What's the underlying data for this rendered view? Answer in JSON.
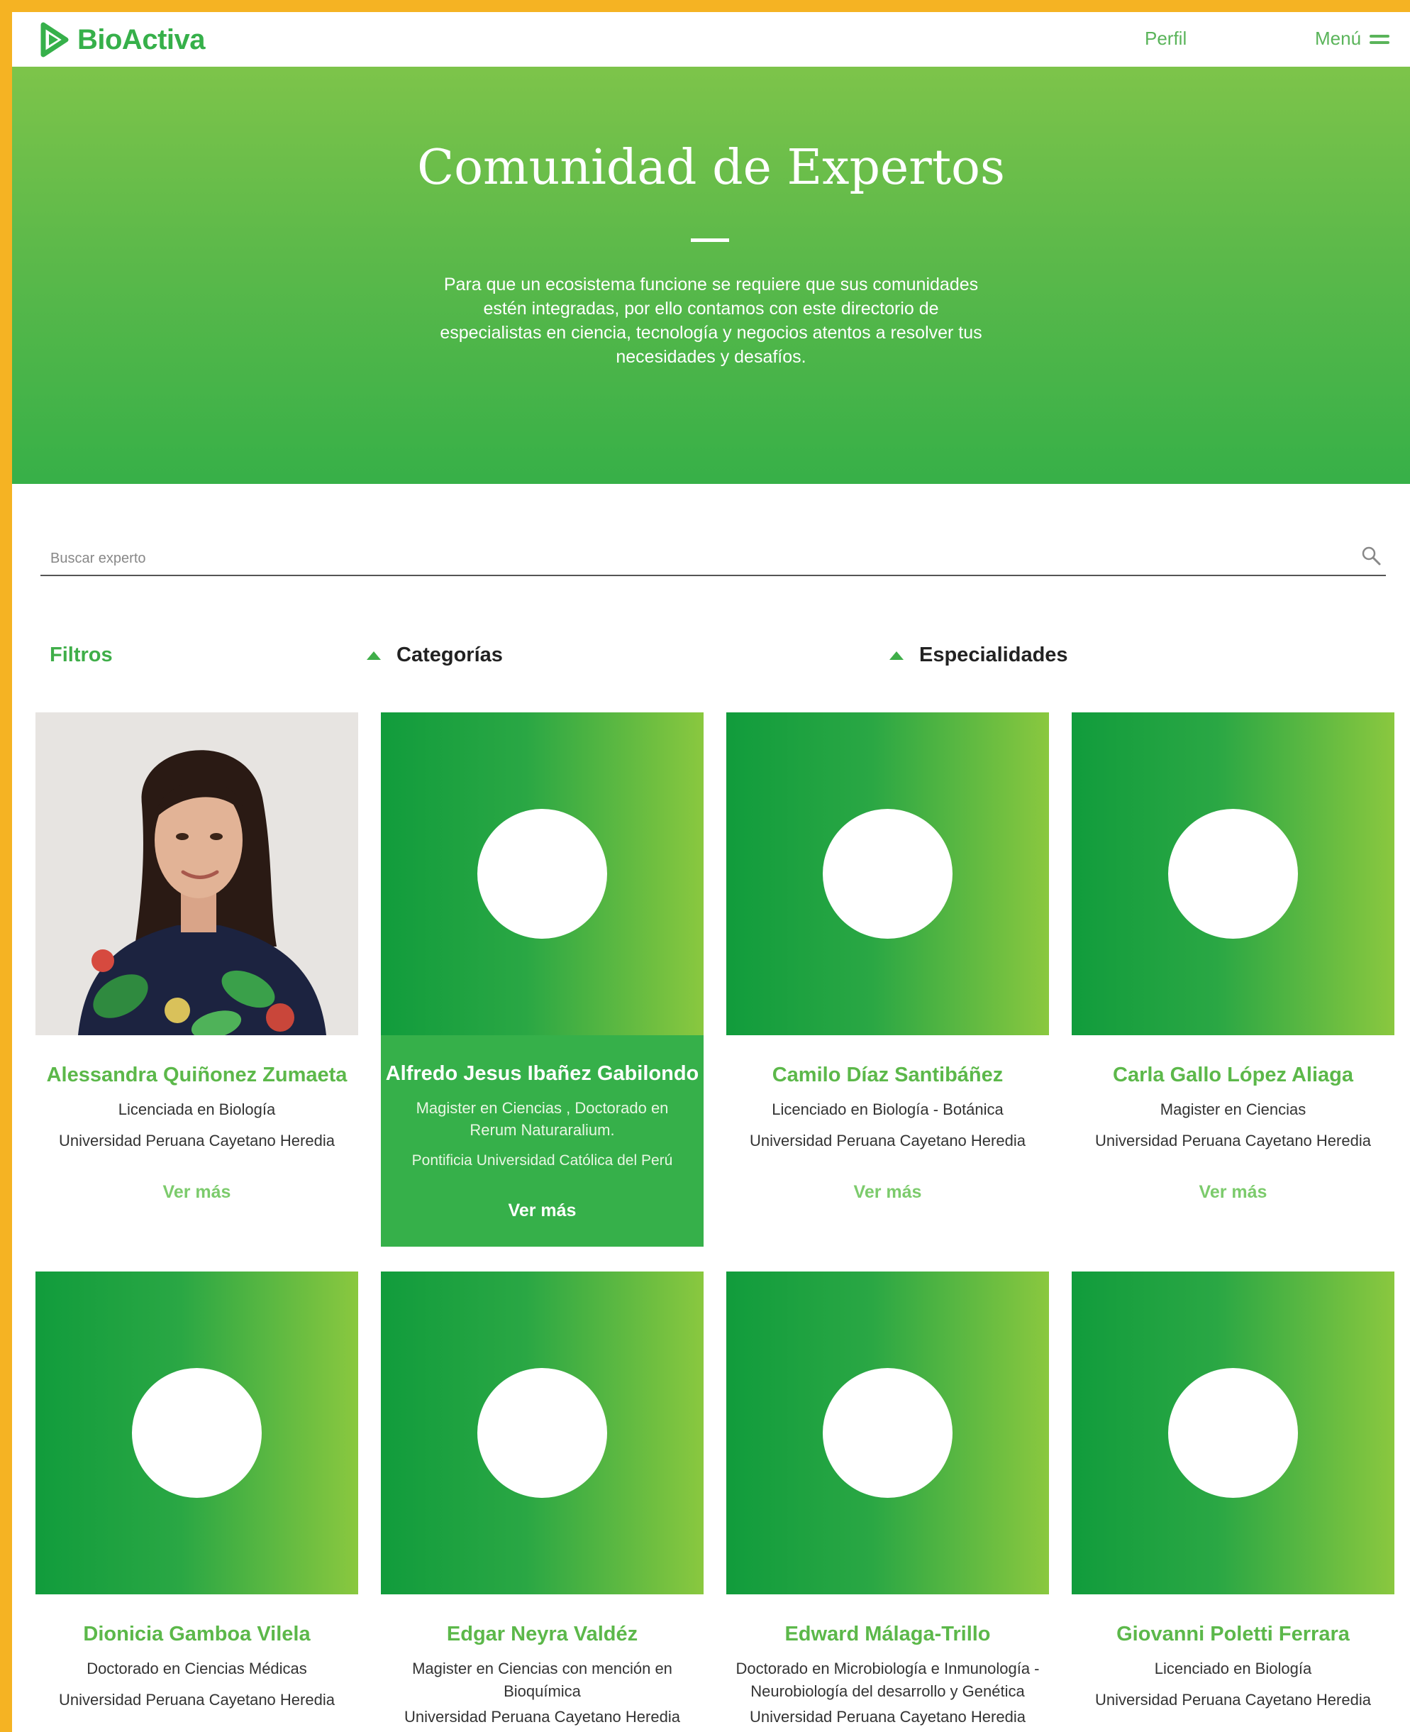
{
  "header": {
    "brand": "BioActiva",
    "profile_label": "Perfil",
    "menu_label": "Menú"
  },
  "hero": {
    "title": "Comunidad de Expertos",
    "description": "Para que un ecosistema funcione se requiere que sus comunidades estén integradas, por ello contamos con este directorio de especialistas en ciencia, tecnología y negocios atentos a resolver tus necesidades y desafíos."
  },
  "search": {
    "placeholder": "Buscar experto"
  },
  "filters": {
    "label": "Filtros",
    "categories_label": "Categorías",
    "specialties_label": "Especialidades"
  },
  "experts": [
    {
      "name": "Alessandra Quiñonez Zumaeta",
      "degree": "Licenciada en Biología",
      "university": "Universidad Peruana Cayetano Heredia",
      "more_label": "Ver más",
      "has_photo": true
    },
    {
      "name": "Alfredo Jesus Ibañez Gabilondo",
      "degree": "Magister en Ciencias , Doctorado en Rerum Naturaralium.",
      "university": "Pontificia Universidad Católica del Perú",
      "more_label": "Ver más",
      "highlighted": true
    },
    {
      "name": "Camilo Díaz Santibáñez",
      "degree": "Licenciado en Biología - Botánica",
      "university": "Universidad Peruana Cayetano Heredia",
      "more_label": "Ver más"
    },
    {
      "name": "Carla Gallo López Aliaga",
      "degree": "Magister en Ciencias",
      "university": "Universidad Peruana Cayetano Heredia",
      "more_label": "Ver más"
    },
    {
      "name": "Dionicia Gamboa Vilela",
      "degree": "Doctorado en Ciencias Médicas",
      "university": "Universidad Peruana Cayetano Heredia"
    },
    {
      "name": "Edgar Neyra Valdéz",
      "degree": "Magister en Ciencias con mención en Bioquímica",
      "university": "Universidad Peruana Cayetano Heredia"
    },
    {
      "name": "Edward Málaga-Trillo",
      "degree": "Doctorado en Microbiología e Inmunología - Neurobiología del desarrollo y Genética",
      "university": "Universidad Peruana Cayetano Heredia"
    },
    {
      "name": "Giovanni Poletti Ferrara",
      "degree": "Licenciado en Biología",
      "university": "Universidad Peruana Cayetano Heredia"
    }
  ],
  "colors": {
    "brand_green": "#36b04a",
    "accent_yellow": "#f5b323",
    "hero_top": "#7dc44a",
    "hero_bottom": "#37b048"
  },
  "icons": {
    "logo": "play-triangle-icon",
    "menu": "hamburger-icon",
    "search": "search-icon",
    "filter_toggle": "caret-up-icon",
    "avatar_placeholder": "circle-placeholder-icon"
  }
}
